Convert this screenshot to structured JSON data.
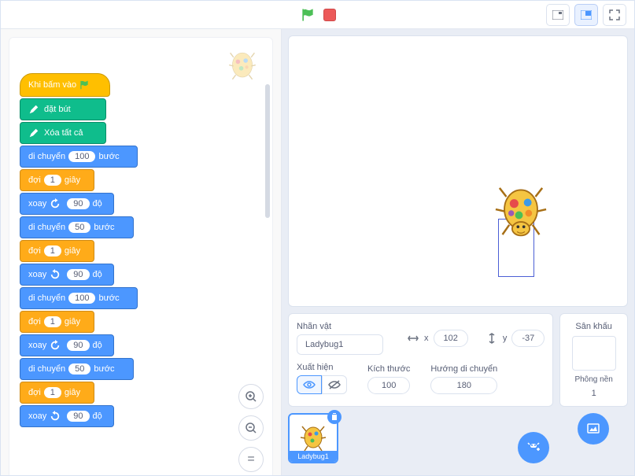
{
  "toolbar": {
    "go": "go",
    "stop": "stop"
  },
  "blocks": {
    "hat": "Khi bấm vào",
    "pen_down": "đặt bút",
    "pen_clear": "Xóa tất cả",
    "move": "di chuyển",
    "steps": "bước",
    "wait": "đợi",
    "secs": "giây",
    "turn": "xoay",
    "deg": "độ",
    "v100": "100",
    "v50": "50",
    "v1": "1",
    "v90": "90"
  },
  "sprite": {
    "panel_label": "Nhãn vật",
    "name": "Ladybug1",
    "x_label": "x",
    "x": "102",
    "y_label": "y",
    "y": "-37",
    "show_label": "Xuất hiện",
    "size_label": "Kích thước",
    "size": "100",
    "dir_label": "Hướng di chuyển",
    "dir": "180",
    "card_label": "Ladybug1"
  },
  "stage": {
    "title": "Sân khấu",
    "backdrops_label": "Phông nền",
    "backdrops_count": "1"
  }
}
